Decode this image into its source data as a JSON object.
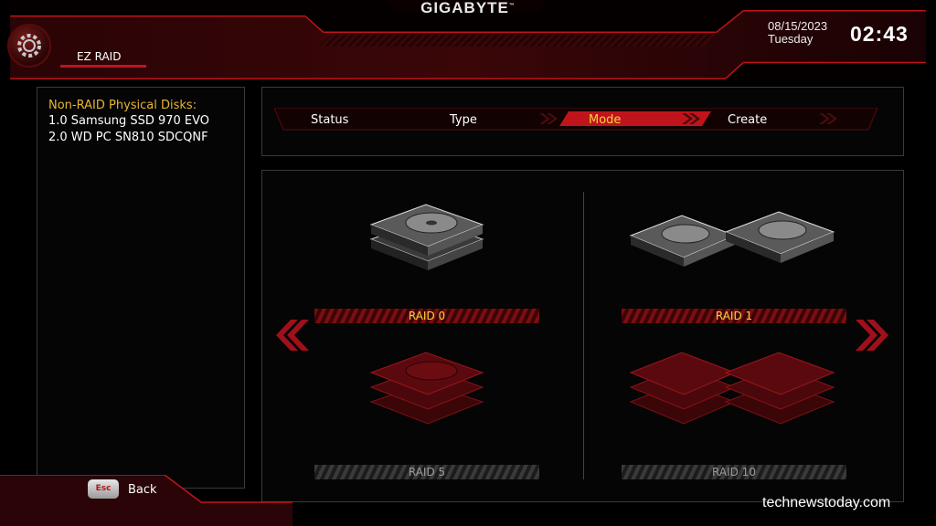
{
  "header": {
    "brand": "GIGABYTE",
    "tab": "EZ RAID",
    "date": "08/15/2023",
    "day": "Tuesday",
    "time": "02:43"
  },
  "disks": {
    "title": "Non-RAID Physical Disks:",
    "items": [
      "1.0  Samsung SSD 970 EVO",
      "2.0  WD PC SN810 SDCQNF"
    ]
  },
  "steps": [
    {
      "label": "Status",
      "active": false
    },
    {
      "label": "Type",
      "active": false
    },
    {
      "label": "Mode",
      "active": true
    },
    {
      "label": "Create",
      "active": false
    }
  ],
  "modes": [
    {
      "label": "RAID 0",
      "selected": true
    },
    {
      "label": "RAID 1",
      "selected": true
    },
    {
      "label": "RAID 5",
      "selected": false
    },
    {
      "label": "RAID 10",
      "selected": false
    }
  ],
  "nav": {
    "prev_icon": "double-chevron-left-icon",
    "next_icon": "double-chevron-right-icon"
  },
  "footer": {
    "esc_key": "Esc",
    "back_label": "Back",
    "watermark": "technewstoday.com"
  },
  "colors": {
    "accent": "#c0141c",
    "highlight": "#f0d23c",
    "disk_title": "#e8b531"
  }
}
